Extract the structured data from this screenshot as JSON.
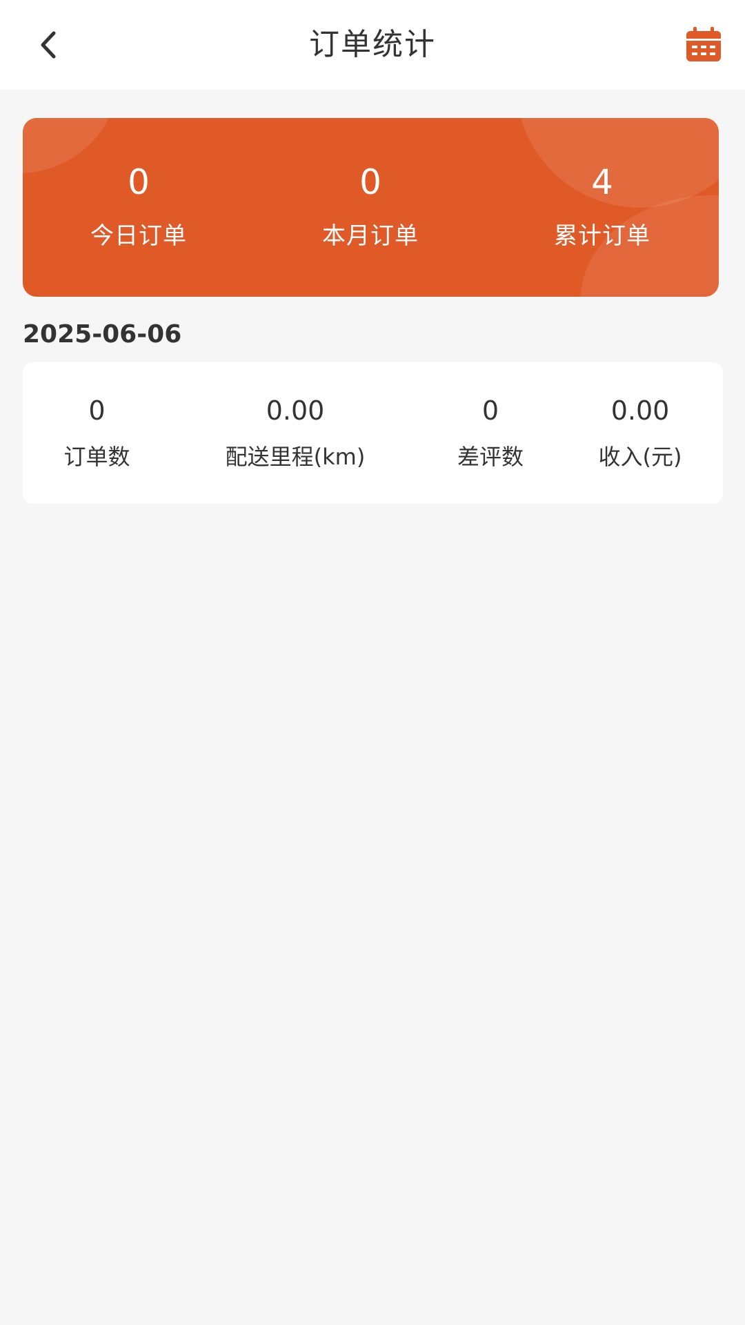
{
  "header": {
    "title": "订单统计",
    "back_icon": "chevron-left-icon",
    "calendar_icon": "calendar-icon",
    "accent_color": "#e05a28"
  },
  "summary": {
    "items": [
      {
        "value": "0",
        "label": "今日订单"
      },
      {
        "value": "0",
        "label": "本月订单"
      },
      {
        "value": "4",
        "label": "累计订单"
      }
    ]
  },
  "date": "2025-06-06",
  "stats": {
    "items": [
      {
        "value": "0",
        "label": "订单数"
      },
      {
        "value": "0.00",
        "label": "配送里程(km)"
      },
      {
        "value": "0",
        "label": "差评数"
      },
      {
        "value": "0.00",
        "label": "收入(元)"
      }
    ]
  }
}
